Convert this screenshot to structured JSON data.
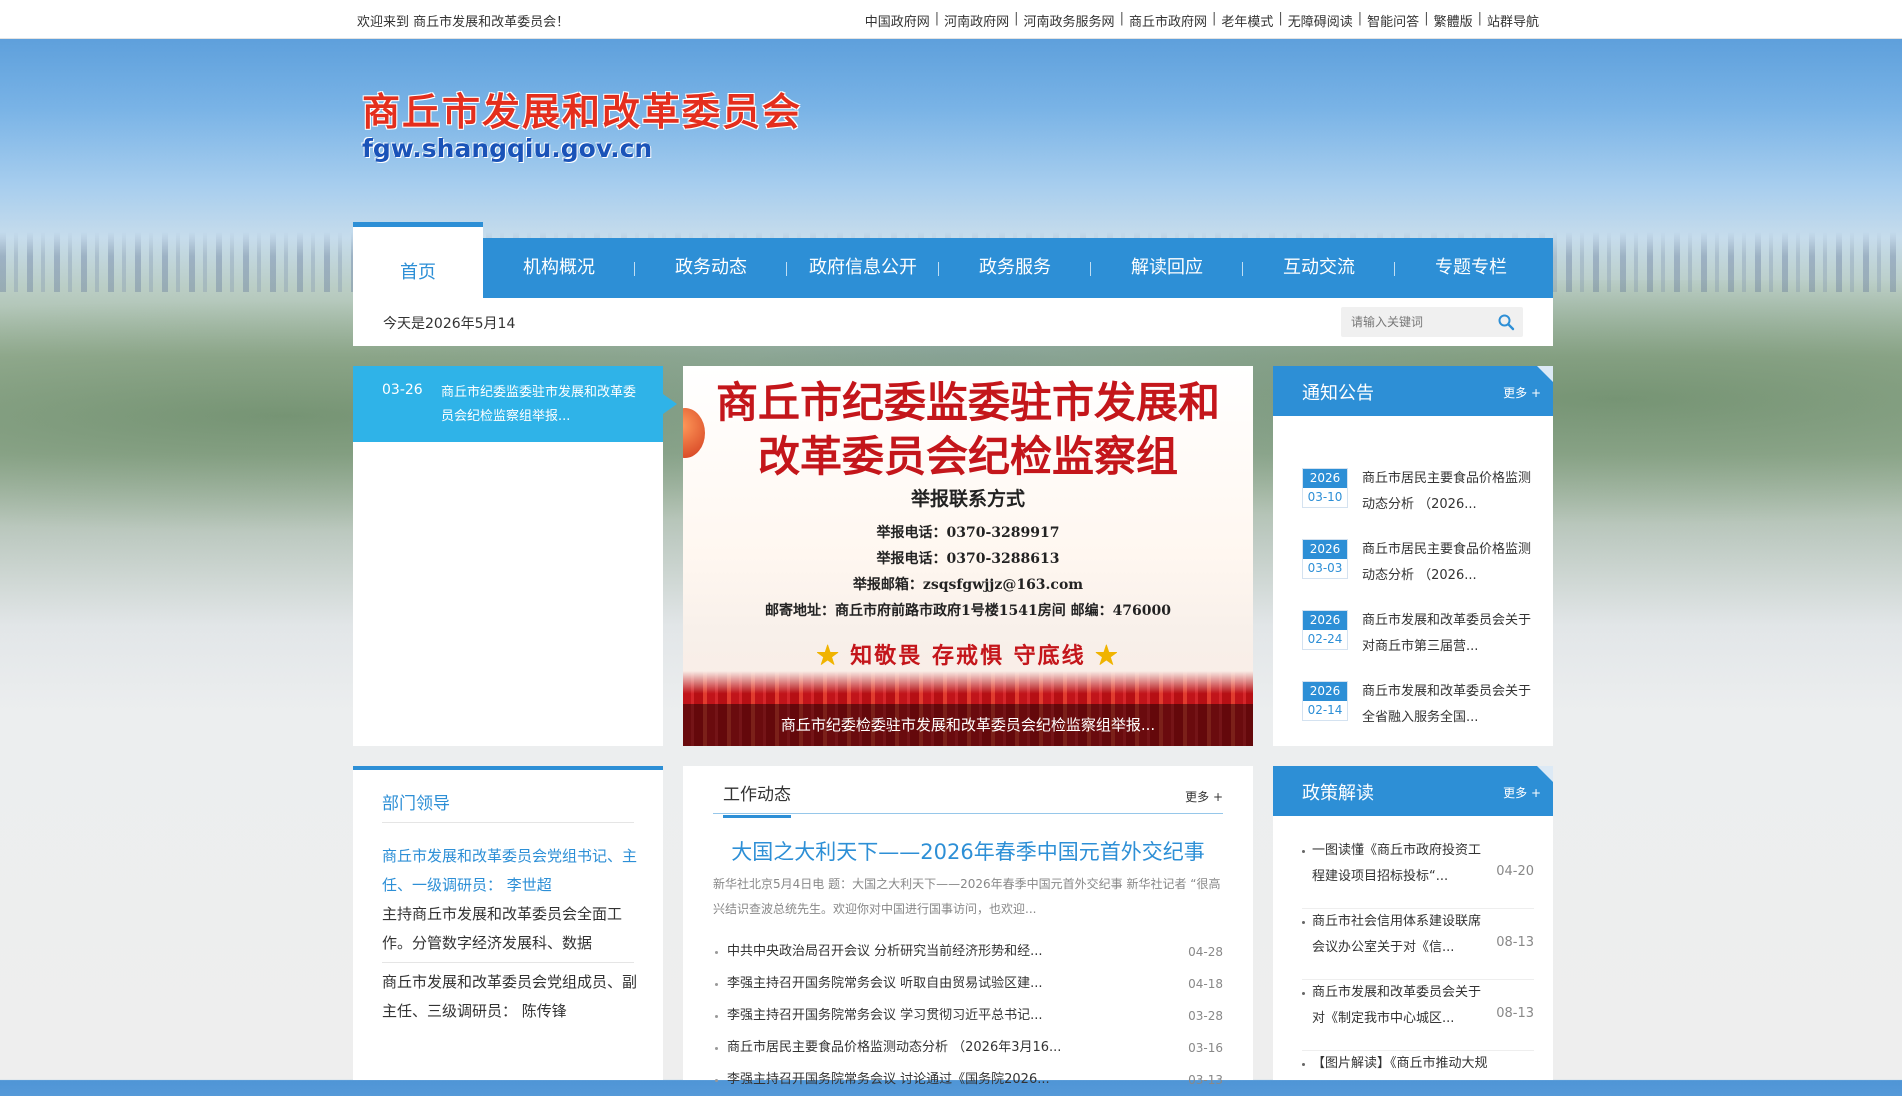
{
  "topbar": {
    "welcome": "欢迎来到 商丘市发展和改革委员会！",
    "links": [
      "中国政府网",
      "河南政府网",
      "河南政务服务网",
      "商丘市政府网",
      "老年模式",
      "无障碍阅读",
      "智能问答",
      "繁體版",
      "站群导航"
    ]
  },
  "logo": {
    "name_cn": "商丘市发展和改革委员会",
    "domain": "fgw.shangqiu.gov.cn"
  },
  "nav": {
    "items": [
      "首页",
      "机构概况",
      "政务动态",
      "政府信息公开",
      "政务服务",
      "解读回应",
      "互动交流",
      "专题专栏"
    ],
    "active_index": 0
  },
  "infobar": {
    "date_text": "今天是2026年5月14",
    "search_placeholder": "请输入关键词"
  },
  "slider_list": {
    "active": {
      "date": "03-26",
      "title": "商丘市纪委监委驻市发展和改革委员会纪检监察组举报..."
    }
  },
  "banner": {
    "title_line1": "商丘市纪委监委驻市发展和",
    "title_line2": "改革委员会纪检监察组",
    "subtitle": "举报联系方式",
    "phone1": "举报电话：0370-3289917",
    "phone2": "举报电话：0370-3288613",
    "email": "举报邮箱：zsqsfgwjjz@163.com",
    "address": "邮寄地址：商丘市府前路市政府1号楼1541房间  邮编：476000",
    "slogan": [
      "知敬畏",
      "存戒惧",
      "守底线"
    ],
    "caption": "商丘市纪委检委驻市发展和改革委员会纪检监察组举报..."
  },
  "notice": {
    "title": "通知公告",
    "more": "更多 +",
    "items": [
      {
        "year": "2026",
        "date": "03-10",
        "title": "商丘市居民主要食品价格监测动态分析 （2026..."
      },
      {
        "year": "2026",
        "date": "03-03",
        "title": "商丘市居民主要食品价格监测动态分析 （2026..."
      },
      {
        "year": "2026",
        "date": "02-24",
        "title": "商丘市发展和改革委员会关于对商丘市第三届营..."
      },
      {
        "year": "2026",
        "date": "02-14",
        "title": "商丘市发展和改革委员会关于全省融入服务全国..."
      }
    ]
  },
  "leaders": {
    "title": "部门领导",
    "leader1_title": "商丘市发展和改革委员会党组书记、主任、一级调研员：",
    "leader1_name": "李世超",
    "leader1_duty": "主持商丘市发展和改革委员会全面工作。分管数字经济发展科、数据",
    "leader2_title": "商丘市发展和改革委员会党组成员、副主任、三级调研员：",
    "leader2_name": "陈传锋"
  },
  "work": {
    "tab": "工作动态",
    "more": "更多 +",
    "headline": "大国之大利天下——2026年春季中国元首外交纪事",
    "summary": "新华社北京5月4日电 题：大国之大利天下——2026年春季中国元首外交纪事 新华社记者 “很高兴结识查波总统先生。欢迎你对中国进行国事访问，也欢迎...",
    "items": [
      {
        "title": "中共中央政治局召开会议 分析研究当前经济形势和经...",
        "date": "04-28"
      },
      {
        "title": "李强主持召开国务院常务会议 听取自由贸易试验区建...",
        "date": "04-18"
      },
      {
        "title": "李强主持召开国务院常务会议 学习贯彻习近平总书记...",
        "date": "03-28"
      },
      {
        "title": "商丘市居民主要食品价格监测动态分析 （2026年3月16...",
        "date": "03-16"
      },
      {
        "title": "李强主持召开国务院常务会议 讨论通过《国务院2026...",
        "date": "03-13"
      }
    ]
  },
  "policy": {
    "title": "政策解读",
    "more": "更多 +",
    "items": [
      {
        "title": "一图读懂《商丘市政府投资工程建设项目招标投标“...",
        "date": "04-20"
      },
      {
        "title": "商丘市社会信用体系建设联席会议办公室关于对《信...",
        "date": "08-13"
      },
      {
        "title": "商丘市发展和改革委员会关于对《制定我市中心城区...",
        "date": "08-13"
      },
      {
        "title": "【图片解读】《商丘市推动大规模",
        "date": ""
      }
    ]
  }
}
